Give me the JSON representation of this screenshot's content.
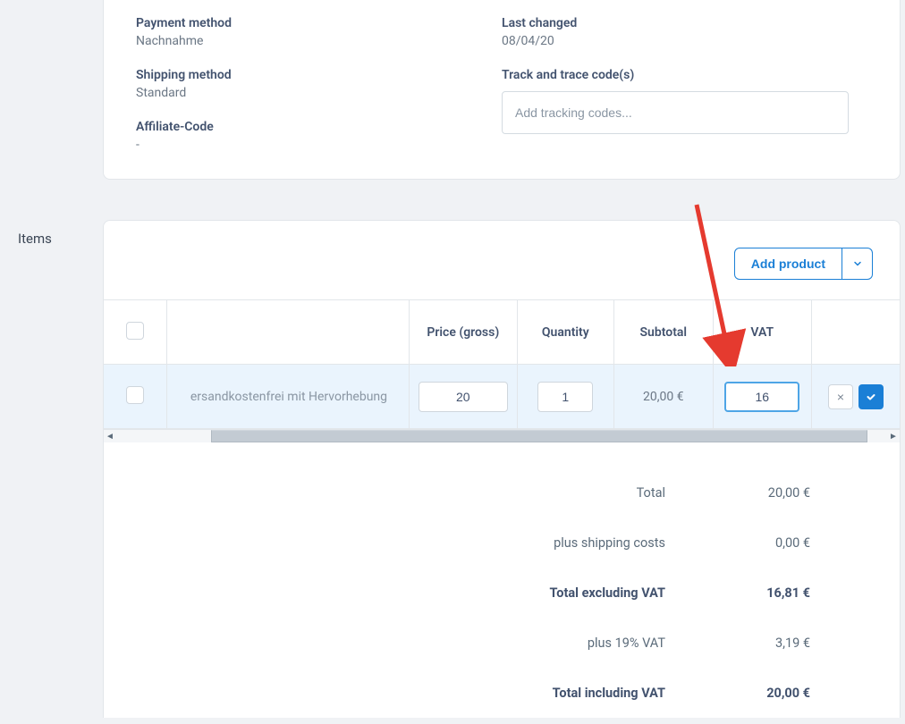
{
  "details": {
    "payment_method_label": "Payment method",
    "payment_method_value": "Nachnahme",
    "shipping_method_label": "Shipping method",
    "shipping_method_value": "Standard",
    "affiliate_code_label": "Affiliate-Code",
    "affiliate_code_value": "-",
    "last_changed_label": "Last changed",
    "last_changed_value": "08/04/20",
    "track_trace_label": "Track and trace code(s)",
    "track_trace_placeholder": "Add tracking codes..."
  },
  "items": {
    "section_label": "Items",
    "add_product_label": "Add product",
    "columns": {
      "price": "Price (gross)",
      "quantity": "Quantity",
      "subtotal": "Subtotal",
      "vat": "VAT"
    },
    "row": {
      "name": "ersandkostenfrei mit Hervorhebung",
      "price": "20",
      "quantity": "1",
      "subtotal": "20,00 €",
      "vat": "16"
    }
  },
  "totals": {
    "total_label": "Total",
    "total_value": "20,00 €",
    "shipping_label": "plus shipping costs",
    "shipping_value": "0,00 €",
    "excl_vat_label": "Total excluding VAT",
    "excl_vat_value": "16,81 €",
    "vat_line_label": "plus 19% VAT",
    "vat_line_value": "3,19 €",
    "incl_vat_label": "Total including VAT",
    "incl_vat_value": "20,00 €"
  }
}
